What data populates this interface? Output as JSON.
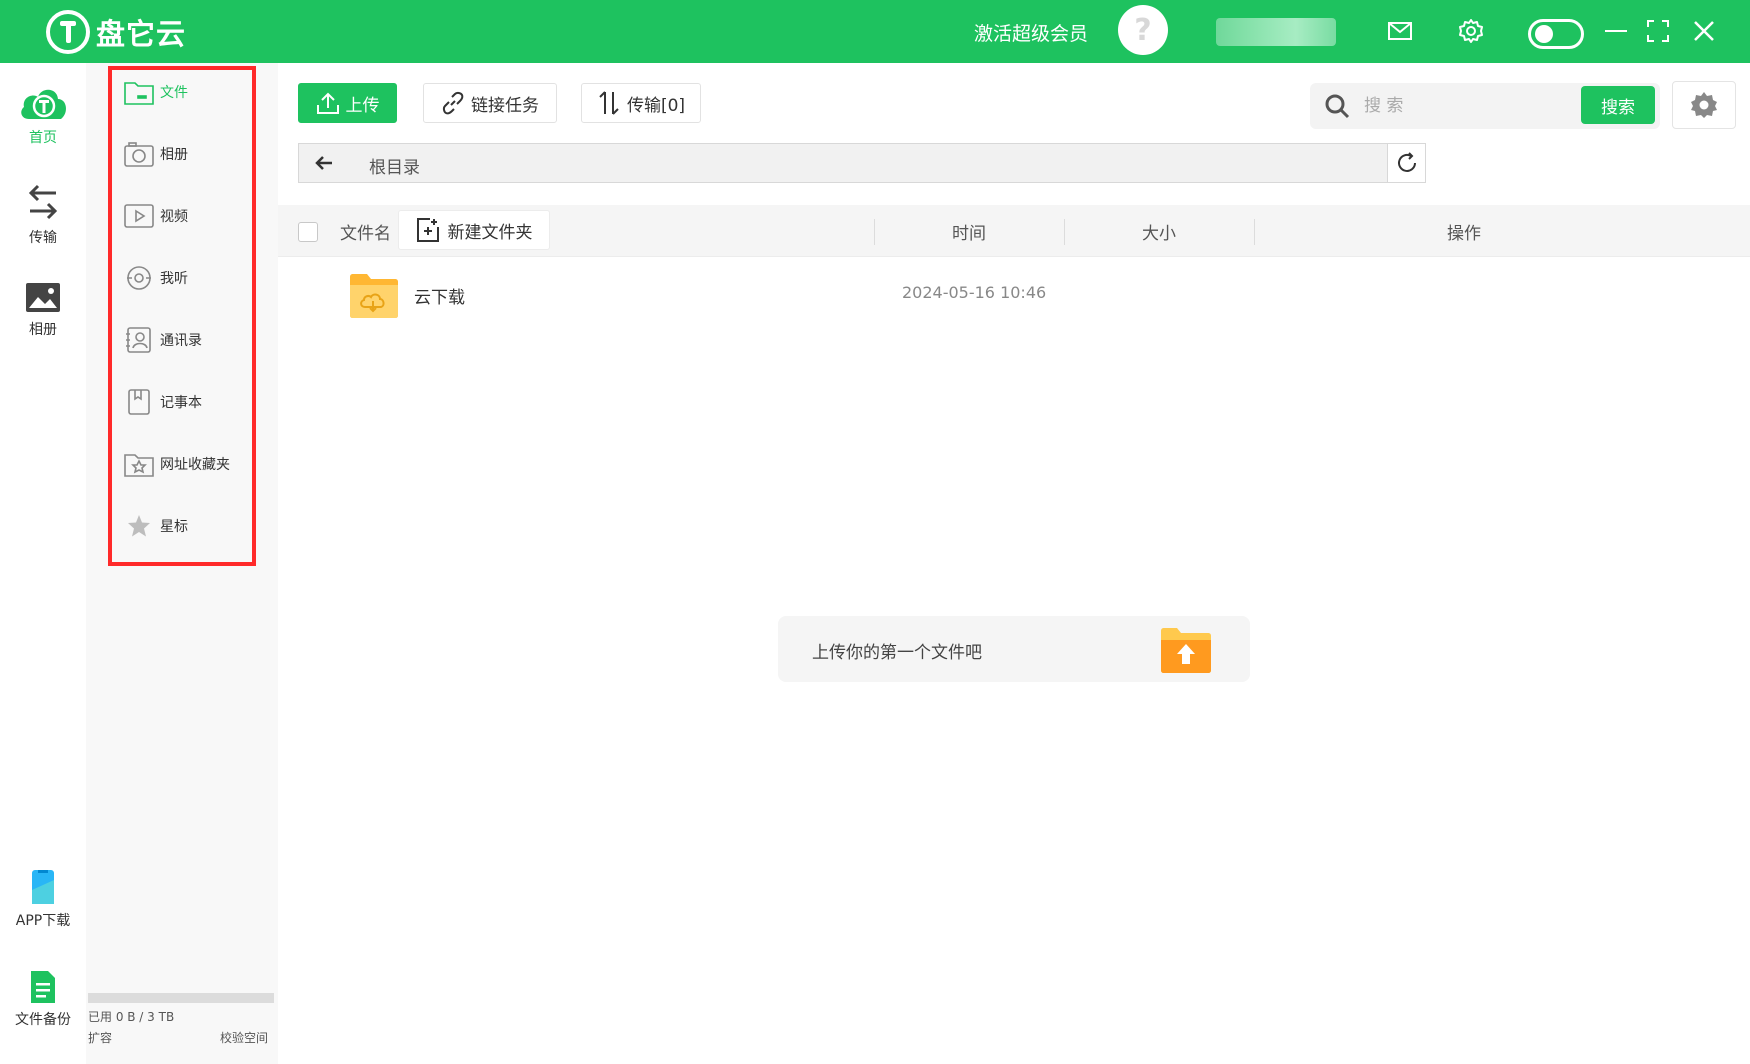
{
  "app": {
    "logo_text": "盘它云",
    "vip_label": "激活超级会员",
    "avatar_glyph": "?",
    "username": "••••••",
    "window_icons": [
      "mail-icon",
      "gear-icon",
      "toggle-switch",
      "minimize-icon",
      "maximize-icon",
      "close-icon"
    ]
  },
  "left_nav": {
    "items": [
      {
        "label": "首页",
        "icon": "cloud-logo-icon",
        "active": true
      },
      {
        "label": "传输",
        "icon": "swap-arrows-icon",
        "active": false
      },
      {
        "label": "相册",
        "icon": "picture-icon",
        "active": false
      }
    ],
    "bottom_items": [
      {
        "label": "APP下载",
        "icon": "phone-icon"
      },
      {
        "label": "文件备份",
        "icon": "document-icon"
      }
    ]
  },
  "categories": {
    "items": [
      {
        "label": "文件",
        "icon": "folder-icon",
        "active": true
      },
      {
        "label": "相册",
        "icon": "camera-icon",
        "active": false
      },
      {
        "label": "视频",
        "icon": "video-icon",
        "active": false
      },
      {
        "label": "我听",
        "icon": "headphones-icon",
        "active": false
      },
      {
        "label": "通讯录",
        "icon": "contacts-icon",
        "active": false
      },
      {
        "label": "记事本",
        "icon": "notebook-icon",
        "active": false
      },
      {
        "label": "网址收藏夹",
        "icon": "bookmark-folder-icon",
        "active": false
      },
      {
        "label": "星标",
        "icon": "star-icon",
        "active": false
      }
    ],
    "storage_used": "已用 0 B / 3 TB",
    "storage_fraction": 0,
    "expand_label": "扩容",
    "verify_label": "校验空间"
  },
  "toolbar": {
    "upload_label": "上传",
    "link_task_label": "链接任务",
    "transfer_label": "传输[0]",
    "search_placeholder": "搜 索",
    "search_button": "搜索"
  },
  "path": {
    "current": "根目录"
  },
  "list": {
    "headers": {
      "name": "文件名",
      "new_folder": "新建文件夹",
      "time": "时间",
      "size": "大小",
      "action": "操作"
    },
    "rows": [
      {
        "name": "云下载",
        "time": "2024-05-16 10:46",
        "size": "",
        "icon": "cloud-folder-icon"
      }
    ]
  },
  "empty_tip": {
    "text": "上传你的第一个文件吧",
    "icon": "upload-folder-icon"
  },
  "colors": {
    "brand_green": "#1ec25f",
    "highlight_red": "#ff2a2a",
    "folder_yellow": "#ffc94d",
    "upload_orange": "#ff9a1f"
  }
}
